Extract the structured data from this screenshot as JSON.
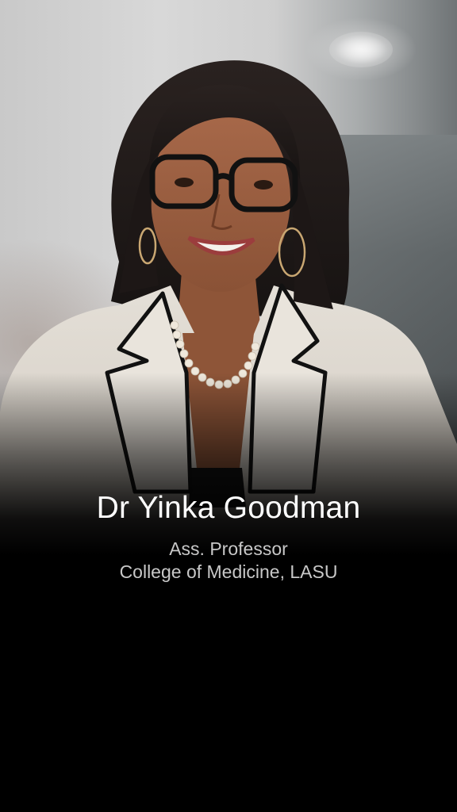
{
  "profile": {
    "name": "Dr Yinka Goodman",
    "title": "Ass. Professor",
    "affiliation": "College of Medicine, LASU"
  },
  "colors": {
    "background": "#000000",
    "name_text": "#ffffff",
    "role_text": "#c8c8c8",
    "blazer": "#e6e1d9",
    "blazer_trim": "#111111"
  },
  "image": {
    "subject": "portrait-photo",
    "icon": "person-portrait"
  }
}
